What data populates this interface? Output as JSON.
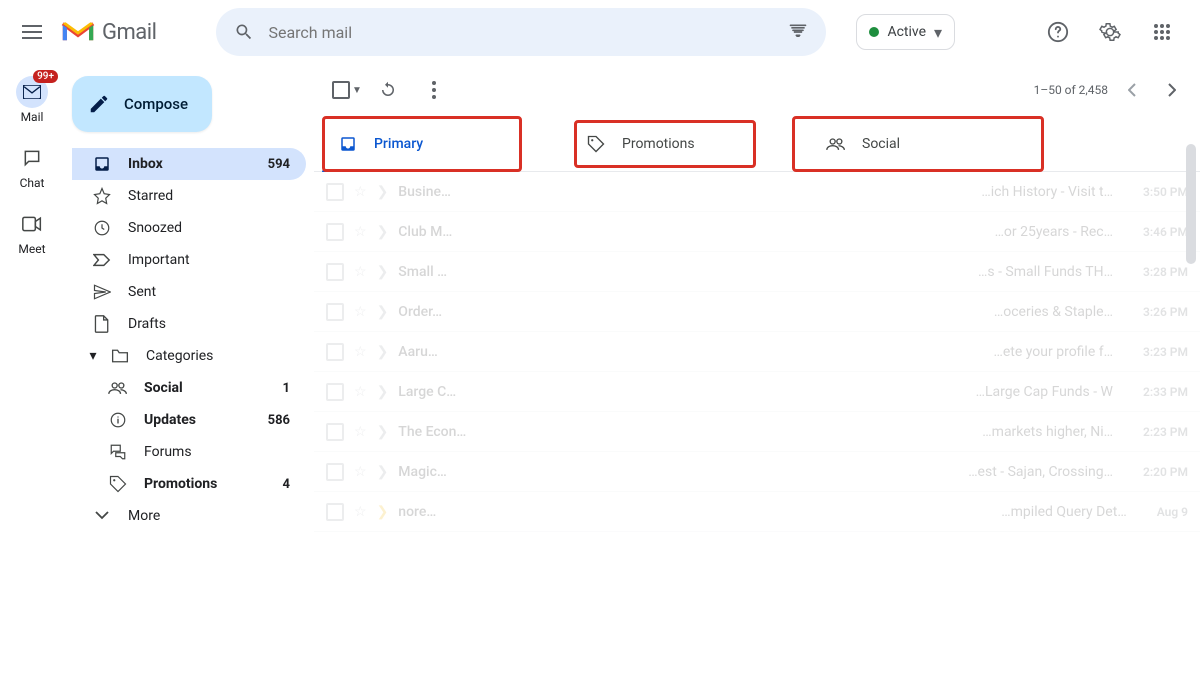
{
  "header": {
    "logo_text": "Gmail",
    "search_placeholder": "Search mail",
    "status_text": "Active"
  },
  "rail": {
    "badge": "99+",
    "mail_label": "Mail",
    "chat_label": "Chat",
    "meet_label": "Meet"
  },
  "compose_label": "Compose",
  "nav": {
    "inbox": {
      "label": "Inbox",
      "count": "594"
    },
    "starred": {
      "label": "Starred"
    },
    "snoozed": {
      "label": "Snoozed"
    },
    "important": {
      "label": "Important"
    },
    "sent": {
      "label": "Sent"
    },
    "drafts": {
      "label": "Drafts"
    },
    "categories": {
      "label": "Categories"
    },
    "social": {
      "label": "Social",
      "count": "1"
    },
    "updates": {
      "label": "Updates",
      "count": "586"
    },
    "forums": {
      "label": "Forums"
    },
    "promotions": {
      "label": "Promotions",
      "count": "4"
    },
    "more": {
      "label": "More"
    }
  },
  "toolbar": {
    "page_range": "1–50 of 2,458"
  },
  "tabs": {
    "primary": "Primary",
    "promotions": "Promotions",
    "social": "Social"
  },
  "emails": [
    {
      "sender": "Busine…",
      "subject": "…ich History - Visit t…",
      "time": "3:50 PM"
    },
    {
      "sender": "Club M…",
      "subject": "…or 25years - Rec…",
      "time": "3:46 PM"
    },
    {
      "sender": "Small …",
      "subject": "…s - Small Funds TH…",
      "time": "3:28 PM"
    },
    {
      "sender": "Order…",
      "subject": "…oceries & Staple…",
      "time": "3:26 PM"
    },
    {
      "sender": "Aaru…",
      "subject": "…ete your profile f…",
      "time": "3:23 PM"
    },
    {
      "sender": "Large C…",
      "subject": "…Large Cap Funds - W",
      "time": "2:33 PM"
    },
    {
      "sender": "The Econ…",
      "subject": "…markets higher, Ni…",
      "time": "2:23 PM"
    },
    {
      "sender": "Magic…",
      "subject": "…est - Sajan, Crossing…",
      "time": "2:20 PM"
    },
    {
      "sender": "nore…",
      "subject": "…mpiled Query Det…",
      "time": "Aug 9"
    }
  ]
}
